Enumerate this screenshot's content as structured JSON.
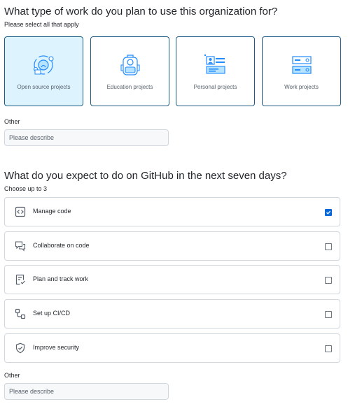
{
  "section1": {
    "title": "What type of work do you plan to use this organization for?",
    "subtitle": "Please select all that apply",
    "cards": [
      {
        "label": "Open source projects",
        "icon": "open-source-icon",
        "selected": true
      },
      {
        "label": "Education projects",
        "icon": "backpack-icon",
        "selected": false
      },
      {
        "label": "Personal projects",
        "icon": "profile-card-icon",
        "selected": false
      },
      {
        "label": "Work projects",
        "icon": "server-icon",
        "selected": false
      }
    ],
    "other_label": "Other",
    "other_placeholder": "Please describe"
  },
  "section2": {
    "title": "What do you expect to do on GitHub in the next seven days?",
    "subtitle": "Choose up to 3",
    "options": [
      {
        "label": "Manage code",
        "icon": "code-square-icon",
        "checked": true
      },
      {
        "label": "Collaborate on code",
        "icon": "comment-discussion-icon",
        "checked": false
      },
      {
        "label": "Plan and track work",
        "icon": "checklist-icon",
        "checked": false
      },
      {
        "label": "Set up CI/CD",
        "icon": "workflow-icon",
        "checked": false
      },
      {
        "label": "Improve security",
        "icon": "shield-check-icon",
        "checked": false
      }
    ],
    "other_label": "Other",
    "other_placeholder": "Please describe"
  },
  "colors": {
    "accent": "#0969da",
    "card_border": "#1f5c85",
    "selected_bg": "#ddf4ff",
    "icon_blue": "#218bff"
  }
}
